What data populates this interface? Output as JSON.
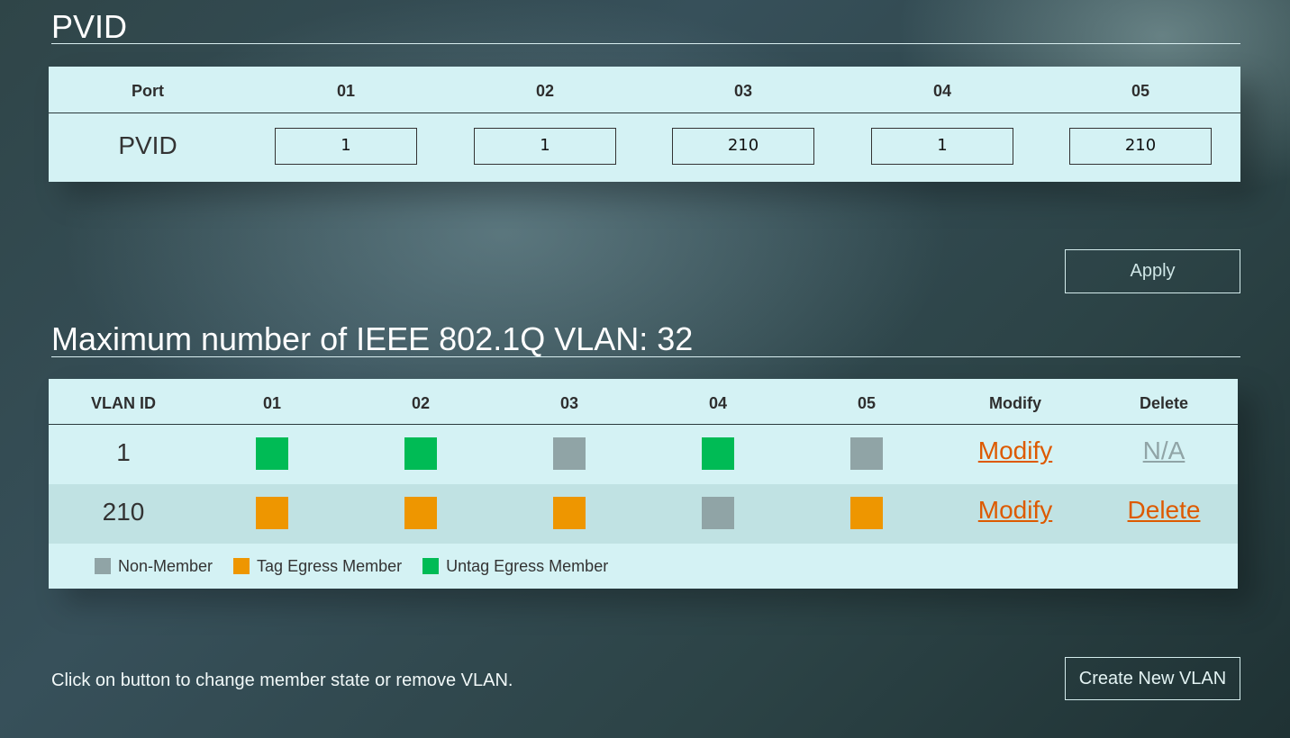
{
  "colors": {
    "non_member": "#90a4a6",
    "tag_egress": "#ee9600",
    "untag_egress": "#00bb55",
    "link": "#dd5a00",
    "link_disabled": "#90a4a6"
  },
  "pvid": {
    "title": "PVID",
    "header_label": "Port",
    "row_label": "PVID",
    "ports": [
      {
        "port": "01",
        "value": "1"
      },
      {
        "port": "02",
        "value": "1"
      },
      {
        "port": "03",
        "value": "210"
      },
      {
        "port": "04",
        "value": "1"
      },
      {
        "port": "05",
        "value": "210"
      }
    ],
    "apply_label": "Apply"
  },
  "vlan": {
    "title": "Maximum number of IEEE 802.1Q VLAN: 32",
    "headers": [
      "VLAN ID",
      "01",
      "02",
      "03",
      "04",
      "05",
      "Modify",
      "Delete"
    ],
    "rows": [
      {
        "id": "1",
        "members": [
          "untag",
          "untag",
          "non",
          "untag",
          "non"
        ],
        "modify": "Modify",
        "delete": "N/A",
        "delete_enabled": false
      },
      {
        "id": "210",
        "members": [
          "tag",
          "tag",
          "tag",
          "non",
          "tag"
        ],
        "modify": "Modify",
        "delete": "Delete",
        "delete_enabled": true
      }
    ],
    "legend": {
      "non_member": "Non-Member",
      "tag_egress": "Tag Egress Member",
      "untag_egress": "Untag Egress Member"
    }
  },
  "footer": {
    "help_text": "Click on button to change member state or remove VLAN.",
    "create_label": "Create New VLAN"
  }
}
